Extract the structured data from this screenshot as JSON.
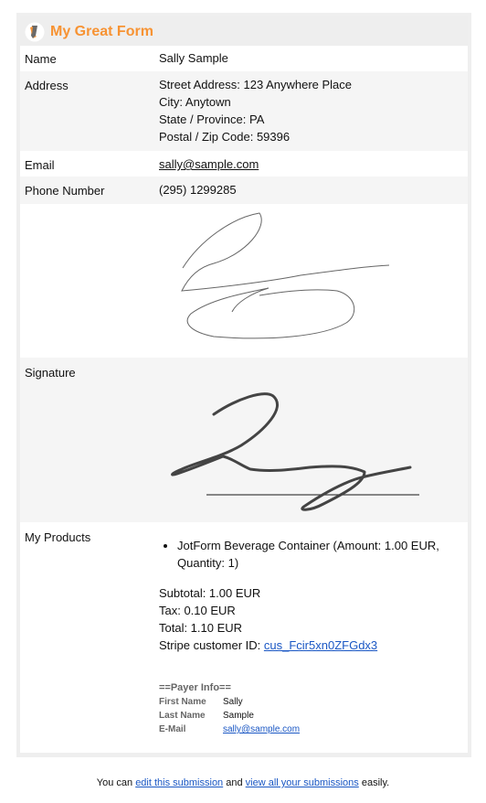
{
  "form": {
    "title": "My Great Form",
    "logo_icon": "jotform-pencil-logo",
    "accent_color": "#f79333"
  },
  "fields": {
    "name": {
      "label": "Name",
      "value": "Sally Sample"
    },
    "address": {
      "label": "Address",
      "street": "Street Address: 123 Anywhere Place",
      "city": "City: Anytown",
      "state": "State / Province: PA",
      "zip": "Postal / Zip Code: 59396"
    },
    "email": {
      "label": "Email",
      "value": "sally@sample.com"
    },
    "phone": {
      "label": "Phone Number",
      "value": "(295) 1299285"
    },
    "signature": {
      "label": "Signature"
    },
    "products": {
      "label": "My Products",
      "items": [
        "JotForm Beverage Container (Amount: 1.00 EUR, Quantity: 1)"
      ],
      "subtotal": "Subtotal: 1.00 EUR",
      "tax": "Tax: 0.10 EUR",
      "total": "Total: 1.10 EUR",
      "stripe_label": "Stripe customer ID:",
      "stripe_id": "cus_Fcir5xn0ZFGdx3",
      "payer": {
        "heading": "==Payer Info==",
        "first_name_label": "First Name",
        "first_name": "Sally",
        "last_name_label": "Last Name",
        "last_name": "Sample",
        "email_label": "E-Mail",
        "email": "sally@sample.com"
      }
    }
  },
  "footer": {
    "prefix": "You can",
    "edit_link": "edit this submission",
    "middle": "and",
    "view_link": "view all your submissions",
    "suffix": "easily."
  }
}
